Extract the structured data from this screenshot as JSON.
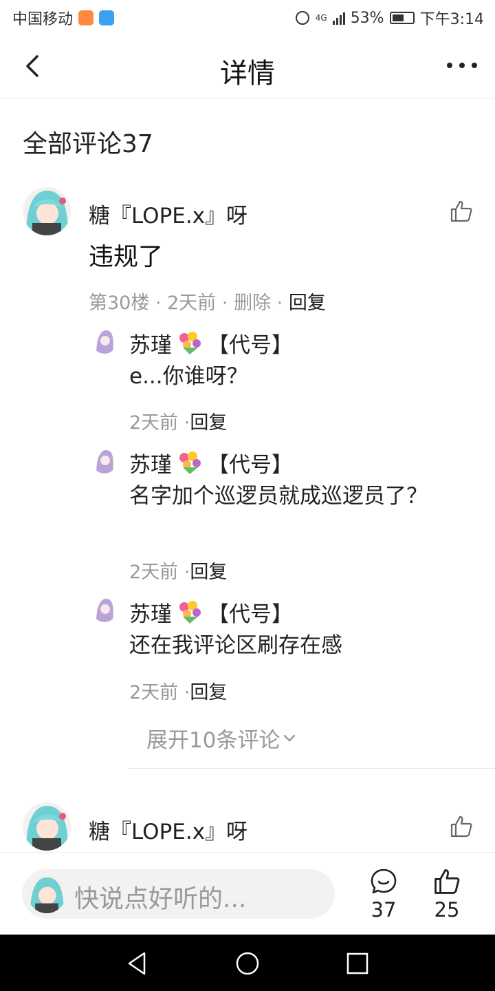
{
  "status_bar": {
    "carrier": "中国移动",
    "network": "4G",
    "battery": "53%",
    "time": "下午3:14"
  },
  "header": {
    "title": "详情"
  },
  "comments_section": {
    "title": "全部评论37"
  },
  "comments": [
    {
      "user": "糖『LOPE.x』呀",
      "text": "违规了",
      "meta_floor": "第30楼",
      "meta_time": "2天前",
      "meta_delete": "删除",
      "meta_reply": "回复"
    },
    {
      "user": "糖『LOPE.x』呀"
    }
  ],
  "replies": [
    {
      "user_prefix": "苏瑾",
      "user_suffix": "【代号】",
      "text": "e...你谁呀？",
      "time": "2天前 ·",
      "reply": "回复"
    },
    {
      "user_prefix": "苏瑾",
      "user_suffix": "【代号】",
      "text": "名字加个巡逻员就成巡逻员了？",
      "time": "2天前 ·",
      "reply": "回复"
    },
    {
      "user_prefix": "苏瑾",
      "user_suffix": "【代号】",
      "text": "还在我评论区刷存在感",
      "time": "2天前 ·",
      "reply": "回复"
    }
  ],
  "expand_label": "展开10条评论",
  "bottom_bar": {
    "placeholder": "快说点好听的...",
    "comment_count": "37",
    "like_count": "25"
  },
  "colors": {
    "muted": "#999999",
    "text": "#222222",
    "nav_bg": "#000000"
  }
}
